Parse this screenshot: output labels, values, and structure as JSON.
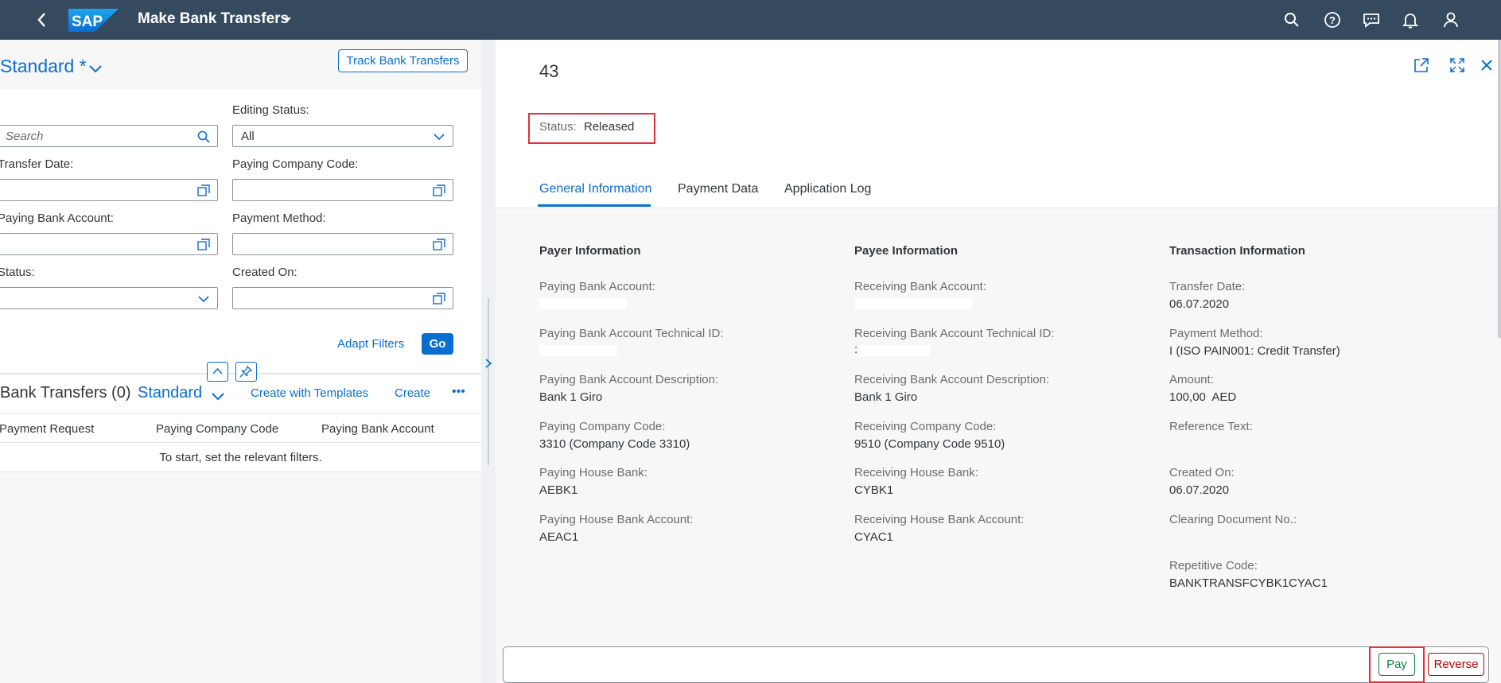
{
  "shell": {
    "app_title": "Make Bank Transfers",
    "logo_text": "SAP",
    "icons": [
      "search-icon",
      "help-icon",
      "feedback-icon",
      "notifications-icon",
      "user-icon"
    ]
  },
  "filter_bar": {
    "variant_name": "Standard *",
    "track_button": "Track Bank Transfers",
    "search_placeholder": "Search",
    "editing_status_label": "Editing Status:",
    "editing_status_value": "All",
    "transfer_date_label": "Transfer Date:",
    "paying_company_code_label": "Paying Company Code:",
    "paying_bank_account_label": "Paying Bank Account:",
    "payment_method_label": "Payment Method:",
    "status_label": "Status:",
    "created_on_label": "Created On:",
    "adapt_filters": "Adapt Filters",
    "go": "Go"
  },
  "table": {
    "title": "Bank Transfers (0)",
    "variant": "Standard",
    "create_with_templates": "Create with Templates",
    "create": "Create",
    "more": "•••",
    "columns": [
      "Payment Request",
      "Paying Company Code",
      "Paying Bank Account"
    ],
    "empty_text": "To start, set the relevant filters."
  },
  "detail": {
    "title": "43",
    "status_label": "Status:",
    "status_value": "Released",
    "tabs": [
      "General Information",
      "Payment Data",
      "Application Log"
    ],
    "payer": {
      "title": "Payer Information",
      "fields": [
        {
          "label": "Paying Bank Account:",
          "value": ""
        },
        {
          "label": "Paying Bank Account Technical ID:",
          "value": ""
        },
        {
          "label": "Paying Bank Account Description:",
          "value": "Bank 1 Giro"
        },
        {
          "label": "Paying Company Code:",
          "value": "3310 (Company Code 3310)"
        },
        {
          "label": "Paying House Bank:",
          "value": "AEBK1"
        },
        {
          "label": "Paying House Bank Account:",
          "value": "AEAC1"
        }
      ]
    },
    "payee": {
      "title": "Payee Information",
      "fields": [
        {
          "label": "Receiving Bank Account:",
          "value": ""
        },
        {
          "label": "Receiving Bank Account Technical ID:",
          "value": ":"
        },
        {
          "label": "Receiving Bank Account Description:",
          "value": "Bank 1 Giro"
        },
        {
          "label": "Receiving Company Code:",
          "value": "9510 (Company Code 9510)"
        },
        {
          "label": "Receiving House Bank:",
          "value": "CYBK1"
        },
        {
          "label": "Receiving House Bank Account:",
          "value": "CYAC1"
        }
      ]
    },
    "transaction": {
      "title": "Transaction Information",
      "fields": [
        {
          "label": "Transfer Date:",
          "value": "06.07.2020"
        },
        {
          "label": "Payment Method:",
          "value": "I (ISO PAIN001: Credit Transfer)"
        },
        {
          "label": "Amount:",
          "value": "100,00  AED"
        },
        {
          "label": "Reference Text:",
          "value": ""
        },
        {
          "label": "Created On:",
          "value": "06.07.2020"
        },
        {
          "label": "Clearing Document No.:",
          "value": ""
        },
        {
          "label": "Repetitive Code:",
          "value": "BANKTRANSFCYBK1CYAC1"
        }
      ]
    },
    "footer": {
      "pay": "Pay",
      "reverse": "Reverse"
    }
  },
  "colors": {
    "shell": "#354a5f",
    "accent": "#0a6ed1",
    "highlight_box": "#e0303a",
    "positive": "#107e3e",
    "negative": "#bb0000"
  }
}
